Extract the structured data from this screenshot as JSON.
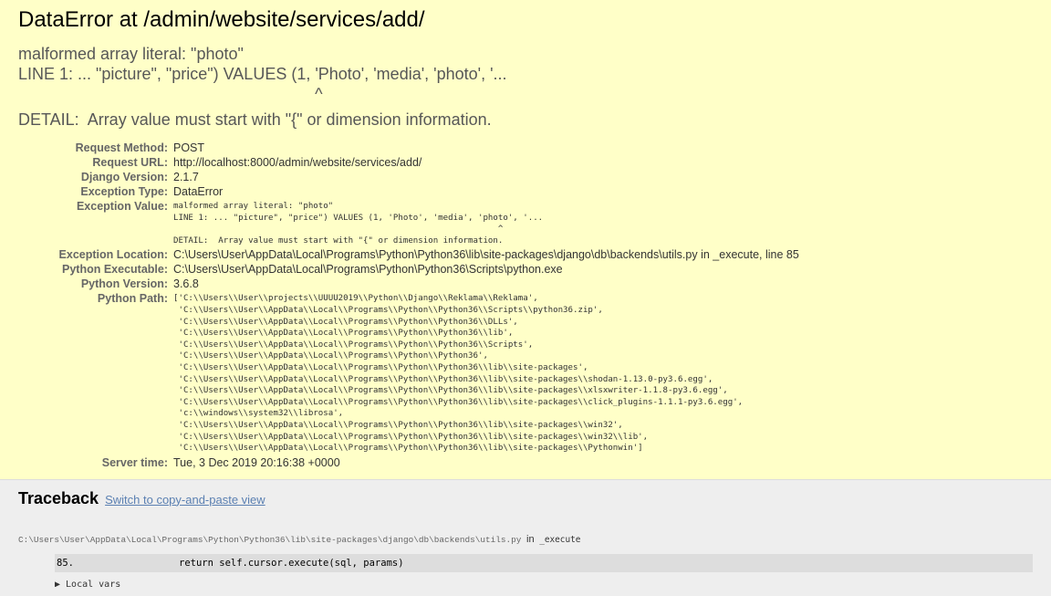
{
  "title": "DataError at /admin/website/services/add/",
  "exception_lines": [
    "malformed array literal: \"photo\"",
    "LINE 1: ... \"picture\", \"price\") VALUES (1, 'Photo', 'media', 'photo', '...",
    "                                                                 ^",
    "DETAIL:  Array value must start with \"{\" or dimension information."
  ],
  "meta": {
    "request_method": {
      "label": "Request Method:",
      "value": "POST"
    },
    "request_url": {
      "label": "Request URL:",
      "value": "http://localhost:8000/admin/website/services/add/"
    },
    "django_version": {
      "label": "Django Version:",
      "value": "2.1.7"
    },
    "exception_type": {
      "label": "Exception Type:",
      "value": "DataError"
    },
    "exception_value": {
      "label": "Exception Value:",
      "value": "malformed array literal: \"photo\"\nLINE 1: ... \"picture\", \"price\") VALUES (1, 'Photo', 'media', 'photo', '...\n                                                                 ^\nDETAIL:  Array value must start with \"{\" or dimension information."
    },
    "exception_location": {
      "label": "Exception Location:",
      "value": "C:\\Users\\User\\AppData\\Local\\Programs\\Python\\Python36\\lib\\site-packages\\django\\db\\backends\\utils.py in _execute, line 85"
    },
    "python_executable": {
      "label": "Python Executable:",
      "value": "C:\\Users\\User\\AppData\\Local\\Programs\\Python\\Python36\\Scripts\\python.exe"
    },
    "python_version": {
      "label": "Python Version:",
      "value": "3.6.8"
    },
    "python_path": {
      "label": "Python Path:",
      "value": "['C:\\\\Users\\\\User\\\\projects\\\\UUUU2019\\\\Python\\\\Django\\\\Reklama\\\\Reklama',\n 'C:\\\\Users\\\\User\\\\AppData\\\\Local\\\\Programs\\\\Python\\\\Python36\\\\Scripts\\\\python36.zip',\n 'C:\\\\Users\\\\User\\\\AppData\\\\Local\\\\Programs\\\\Python\\\\Python36\\\\DLLs',\n 'C:\\\\Users\\\\User\\\\AppData\\\\Local\\\\Programs\\\\Python\\\\Python36\\\\lib',\n 'C:\\\\Users\\\\User\\\\AppData\\\\Local\\\\Programs\\\\Python\\\\Python36\\\\Scripts',\n 'C:\\\\Users\\\\User\\\\AppData\\\\Local\\\\Programs\\\\Python\\\\Python36',\n 'C:\\\\Users\\\\User\\\\AppData\\\\Local\\\\Programs\\\\Python\\\\Python36\\\\lib\\\\site-packages',\n 'C:\\\\Users\\\\User\\\\AppData\\\\Local\\\\Programs\\\\Python\\\\Python36\\\\lib\\\\site-packages\\\\shodan-1.13.0-py3.6.egg',\n 'C:\\\\Users\\\\User\\\\AppData\\\\Local\\\\Programs\\\\Python\\\\Python36\\\\lib\\\\site-packages\\\\xlsxwriter-1.1.8-py3.6.egg',\n 'C:\\\\Users\\\\User\\\\AppData\\\\Local\\\\Programs\\\\Python\\\\Python36\\\\lib\\\\site-packages\\\\click_plugins-1.1.1-py3.6.egg',\n 'c:\\\\windows\\\\system32\\\\librosa',\n 'C:\\\\Users\\\\User\\\\AppData\\\\Local\\\\Programs\\\\Python\\\\Python36\\\\lib\\\\site-packages\\\\win32',\n 'C:\\\\Users\\\\User\\\\AppData\\\\Local\\\\Programs\\\\Python\\\\Python36\\\\lib\\\\site-packages\\\\win32\\\\lib',\n 'C:\\\\Users\\\\User\\\\AppData\\\\Local\\\\Programs\\\\Python\\\\Python36\\\\lib\\\\site-packages\\\\Pythonwin']"
    },
    "server_time": {
      "label": "Server time:",
      "value": "Tue, 3 Dec 2019 20:16:38 +0000"
    }
  },
  "traceback": {
    "heading": "Traceback",
    "switch_link": "Switch to copy-and-paste view",
    "frame_file": "C:\\Users\\User\\AppData\\Local\\Programs\\Python\\Python36\\lib\\site-packages\\django\\db\\backends\\utils.py",
    "frame_in": "in",
    "frame_function": "_execute",
    "context_line_number": "85.",
    "context_line_code": "return self.cursor.execute(sql, params)",
    "next_line_partial": "▶ Local vars"
  },
  "colors": {
    "summary_bg": "#ffffc8",
    "page_bg": "#eeeeee",
    "link": "#5b80b2",
    "context_bg": "#dddddd"
  }
}
